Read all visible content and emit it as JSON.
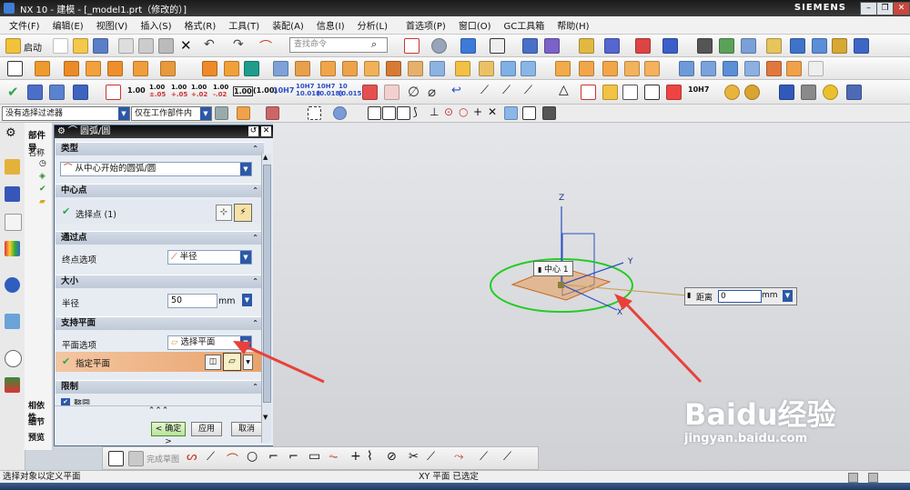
{
  "window": {
    "title": "NX 10 - 建模 - [_model1.prt（修改的）]",
    "brand": "SIEMENS"
  },
  "menu": [
    "文件(F)",
    "编辑(E)",
    "视图(V)",
    "插入(S)",
    "格式(R)",
    "工具(T)",
    "装配(A)",
    "信息(I)",
    "分析(L)",
    "首选项(P)",
    "窗口(O)",
    "GC工具箱",
    "帮助(H)"
  ],
  "toolbar": {
    "start_label": "启动",
    "search_placeholder": "查找命令"
  },
  "filter": {
    "selection_filter": "没有选择过滤器",
    "scope": "仅在工作部件内"
  },
  "nav": {
    "title": "部件导",
    "col_name": "名称",
    "bottom": [
      "相依性",
      "细节",
      "预览"
    ]
  },
  "dialog": {
    "title": "圆弧/圆",
    "sections": {
      "type": {
        "title": "类型",
        "value": "从中心开始的圆弧/圆"
      },
      "center": {
        "title": "中心点",
        "select_label": "选择点 (1)"
      },
      "through": {
        "title": "通过点",
        "end_option_label": "终点选项",
        "end_option_value": "半径"
      },
      "size": {
        "title": "大小",
        "radius_label": "半径",
        "radius_value": "50",
        "radius_unit": "mm"
      },
      "support": {
        "title": "支持平面",
        "plane_option_label": "平面选项",
        "plane_option_value": "选择平面",
        "specify_plane": "指定平面"
      },
      "limits": {
        "title": "限制",
        "full_circle": "整圆"
      }
    },
    "buttons": {
      "ok": "< 确定 >",
      "apply": "应用",
      "cancel": "取消"
    },
    "more": "⌃⌃⌃"
  },
  "viewport": {
    "axis_z": "Z",
    "axis_y": "Y",
    "axis_x": "X",
    "center_tag": "中心 1",
    "distance_label": "距离",
    "distance_value": "0",
    "distance_unit": "mm"
  },
  "sketch_toolbar": {
    "finish_label": "完成草图"
  },
  "status": {
    "left": "选择对象以定义平面",
    "center": "XY 平面 已选定"
  },
  "watermark": {
    "brand": "Baidu经验",
    "url": "jingyan.baidu.com"
  },
  "colors": {
    "circle": "#22cc22",
    "plane": "#e89a55",
    "arrow": "#e8413a",
    "axis": "#2b4ec4",
    "wcs_line": "#c9a45a"
  }
}
